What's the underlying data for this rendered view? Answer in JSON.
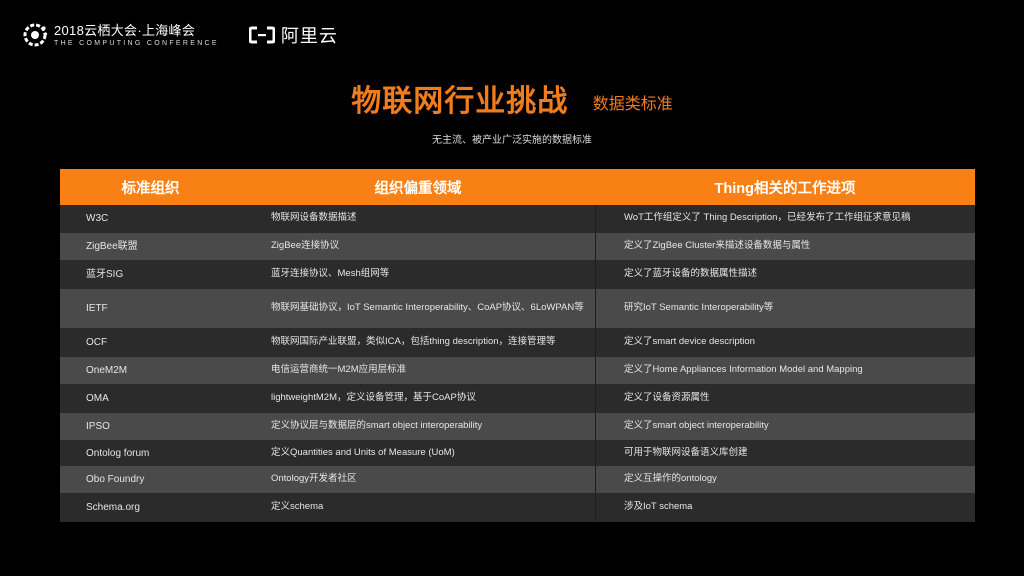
{
  "header": {
    "conference_title": "2018云栖大会·上海峰会",
    "conference_subtitle": "THE COMPUTING CONFERENCE",
    "brand_name": "阿里云"
  },
  "slide": {
    "title": "物联网行业挑战",
    "subtitle": "数据类标准",
    "caption": "无主流、被产业广泛实施的数据标准"
  },
  "table": {
    "headers": [
      "标准组织",
      "组织偏重领域",
      "Thing相关的工作进项"
    ],
    "rows": [
      {
        "org": "W3C",
        "focus": "物联网设备数据描述",
        "work": "WoT工作组定义了 Thing Description，已经发布了工作组征求意见稿"
      },
      {
        "org": "ZigBee联盟",
        "focus": "ZigBee连接协议",
        "work": "定义了ZigBee Cluster来描述设备数据与属性"
      },
      {
        "org": "蓝牙SIG",
        "focus": "蓝牙连接协议、Mesh组网等",
        "work": "定义了蓝牙设备的数据属性描述"
      },
      {
        "org": "IETF",
        "focus": "物联网基础协议，IoT Semantic Interoperability、CoAP协议、6LoWPAN等",
        "work": "研究IoT Semantic Interoperability等"
      },
      {
        "org": "OCF",
        "focus": "物联网国际产业联盟，类似ICA，包括thing description，连接管理等",
        "work": "定义了smart device description"
      },
      {
        "org": "OneM2M",
        "focus": "电信运营商统一M2M应用层标准",
        "work": "定义了Home Appliances Information Model and Mapping"
      },
      {
        "org": "OMA",
        "focus": "lightweightM2M，定义设备管理，基于CoAP协议",
        "work": "定义了设备资源属性"
      },
      {
        "org": "IPSO",
        "focus": "定义协议层与数据层的smart object interoperability",
        "work": "定义了smart object interoperability"
      },
      {
        "org": "Ontolog forum",
        "focus": "定义Quantities and Units of Measure (UoM)",
        "work": "可用于物联网设备语义库创建"
      },
      {
        "org": "Obo Foundry",
        "focus": "Ontology开发者社区",
        "work": "定义互操作的ontology"
      },
      {
        "org": "Schema.org",
        "focus": "定义schema",
        "work": "涉及IoT schema"
      }
    ]
  }
}
